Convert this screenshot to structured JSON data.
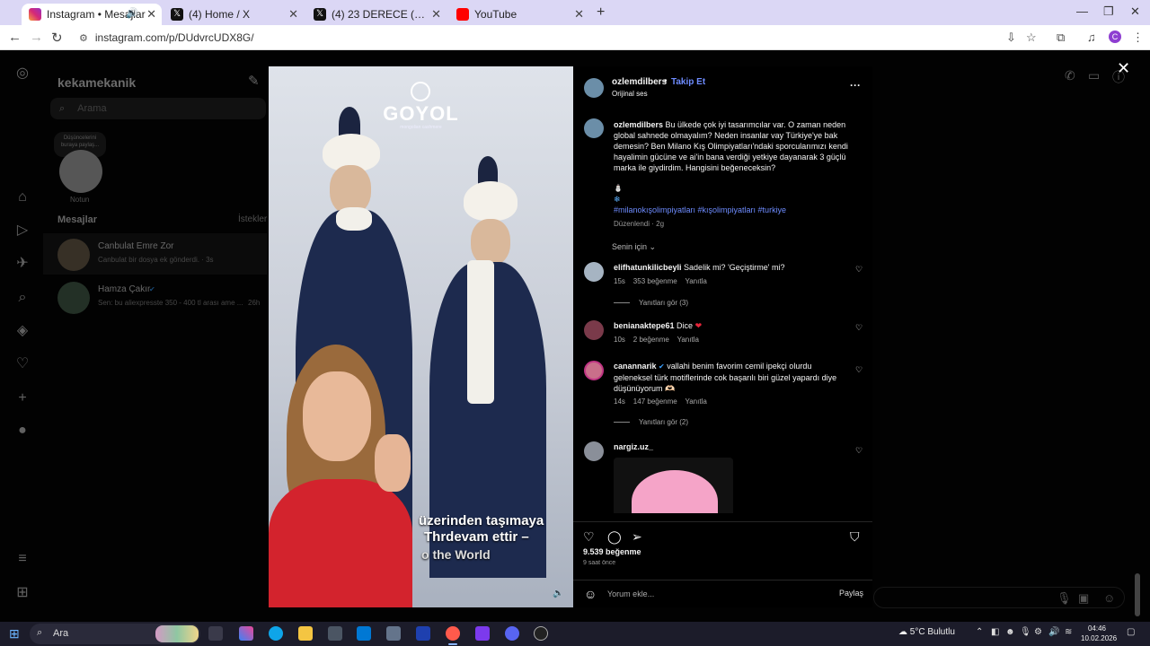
{
  "browser": {
    "tabs": [
      {
        "label": "Instagram • Mesajlar",
        "icon": "instagram-icon",
        "active": true,
        "audio": true
      },
      {
        "label": "(4) Home / X",
        "icon": "x-icon"
      },
      {
        "label": "(4) 23 DERECE (@yirmiucderece",
        "icon": "x-icon"
      },
      {
        "label": "YouTube",
        "icon": "youtube-icon"
      }
    ],
    "url": "instagram.com/p/DUdvrcUDX8G/",
    "profile_initial": "C"
  },
  "background": {
    "username": "kekamekanik",
    "search_placeholder": "Arama",
    "note_bubble": "Düşüncelerini buraya paylaş...",
    "note_label": "Notun",
    "messages_title": "Mesajlar",
    "requests": "İstekler",
    "threads": [
      {
        "name": "Canbulat Emre Zor",
        "preview": "Canbulat bir dosya ek gönderdi. · 3s"
      },
      {
        "name": "Hamza Çakır",
        "preview": "Sen: bu aliexpresste 350 - 400 tl arası ame ...",
        "time": "26h",
        "verified": true
      }
    ]
  },
  "post": {
    "media": {
      "brand": "GOYOL",
      "brand_sub": "mongolian cashmere",
      "caption_lines": [
        "üzerinden taşımaya",
        "Thrdevam ettir –",
        "o the World"
      ]
    },
    "author": "ozlemdilbers",
    "follow_label": "Takip Et",
    "audio": "Orijinal ses",
    "caption_user": "ozlemdilbers",
    "caption": "Bu ülkede çok iyi tasarımcılar var. O zaman neden global sahnede olmayalım? Neden insanlar vay Türkiye'ye bak demesin? Ben Milano Kış Olimpiyatları'ndaki sporcularımızı kendi hayalimin gücüne ve ai'in bana verdiği yetkiye dayanarak 3 güçlü marka ile giydirdim. Hangisini beğeneceksin?",
    "hashtags": "#milanokışolimpiyatları #kışolimpiyatları #turkiye",
    "edited": "Düzenlendi · 2g",
    "sort": "Senin için",
    "comments": [
      {
        "user": "elifhatunkilicbeyli",
        "text": "Sadelik mi? 'Geçiştirme' mi?",
        "age": "15s",
        "likes": "353 beğenme",
        "reply": "Yanıtla",
        "replies": "Yanıtları gör (3)"
      },
      {
        "user": "benianaktepe61",
        "text": "Dice",
        "age": "10s",
        "likes": "2 beğenme",
        "reply": "Yanıtla"
      },
      {
        "user": "canannarik",
        "text": "vallahi benim favorim cemil ipekçi olurdu geleneksel türk motiflerinde cok başarılı biri güzel yapardı diye düşünüyorum 🫶🏻",
        "age": "14s",
        "likes": "147 beğenme",
        "reply": "Yanıtla",
        "replies": "Yanıtları gör (2)",
        "verified": true
      },
      {
        "user": "nargiz.uz_",
        "text": ""
      }
    ],
    "like_count": "9.539 beğenme",
    "posted": "9 saat önce",
    "comment_placeholder": "Yorum ekle...",
    "post_label": "Paylaş"
  },
  "taskbar": {
    "search": "Ara",
    "weather": "5°C  Bulutlu",
    "time": "04:46",
    "date": "10.02.2026"
  }
}
